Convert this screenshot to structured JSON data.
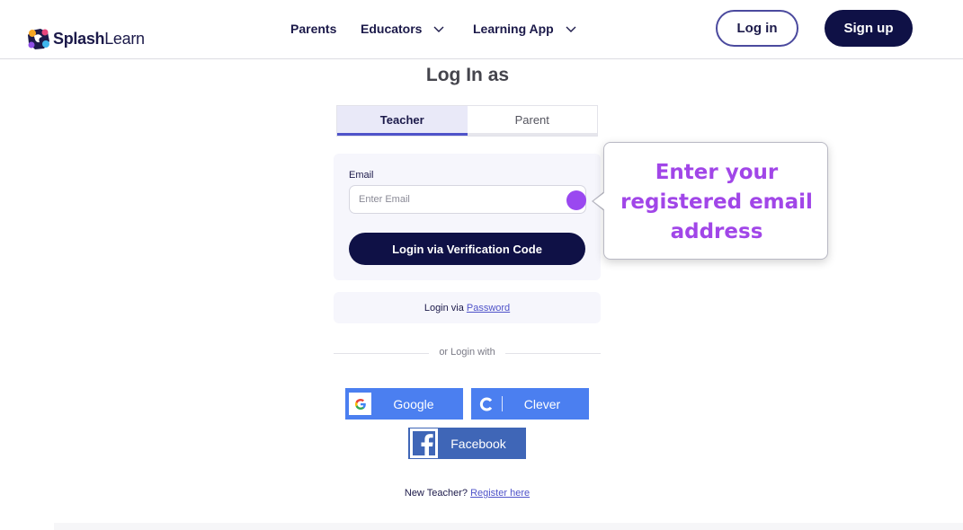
{
  "header": {
    "logo": {
      "splash": "Splash",
      "learn": "Learn"
    },
    "nav": [
      {
        "label": "Parents",
        "has_dropdown": false
      },
      {
        "label": "Educators",
        "has_dropdown": true
      },
      {
        "label": "Learning App",
        "has_dropdown": true
      }
    ],
    "login_label": "Log in",
    "signup_label": "Sign up"
  },
  "main": {
    "title": "Log In as",
    "tabs": [
      {
        "label": "Teacher",
        "active": true
      },
      {
        "label": "Parent",
        "active": false
      }
    ],
    "form": {
      "email_label": "Email",
      "email_placeholder": "Enter Email",
      "email_value": "",
      "submit_label": "Login via Verification Code"
    },
    "password_row": {
      "prefix": "Login via",
      "link": "Password"
    },
    "divider_text": "or Login with",
    "sso": {
      "google": "Google",
      "clever": "Clever",
      "facebook": "Facebook"
    },
    "register": {
      "prefix": "New Teacher?",
      "link": "Register here"
    }
  },
  "tooltip": {
    "lines": [
      "Enter your",
      "registered email",
      "address"
    ]
  },
  "colors": {
    "brand_navy": "#0f1146",
    "accent_purple": "#a146e8",
    "tab_underline": "#4f53c9",
    "google_blue": "#4b7ff0",
    "facebook_blue": "#3f66b7"
  },
  "icons": [
    "splashlearn-logo-icon",
    "chevron-down-icon",
    "google-icon",
    "clever-icon",
    "facebook-icon"
  ]
}
